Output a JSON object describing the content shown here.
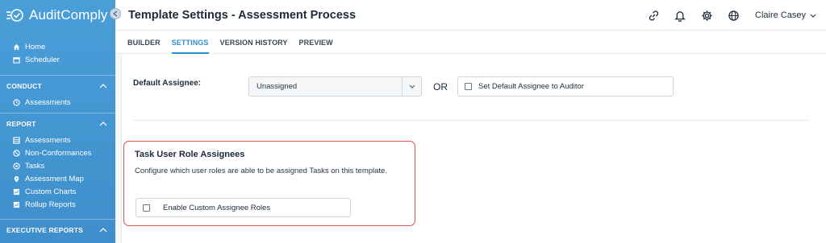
{
  "app": {
    "name": "AuditComply"
  },
  "colors": {
    "sidebar": "#4a9ed8",
    "accent": "#2b8fd0",
    "highlight_border": "#d9534f"
  },
  "sidebar": {
    "top_items": [
      {
        "label": "Home",
        "icon": "home-icon"
      },
      {
        "label": "Scheduler",
        "icon": "calendar-icon"
      }
    ],
    "sections": [
      {
        "title": "CONDUCT",
        "items": [
          {
            "label": "Assessments",
            "icon": "clock-icon"
          }
        ]
      },
      {
        "title": "REPORT",
        "items": [
          {
            "label": "Assessments",
            "icon": "table-icon"
          },
          {
            "label": "Non-Conformances",
            "icon": "warning-icon"
          },
          {
            "label": "Tasks",
            "icon": "tasks-icon"
          },
          {
            "label": "Assessment Map",
            "icon": "map-pin-icon"
          },
          {
            "label": "Custom Charts",
            "icon": "chart-icon"
          },
          {
            "label": "Rollup Reports",
            "icon": "chart-icon"
          }
        ]
      },
      {
        "title": "EXECUTIVE REPORTS",
        "items": []
      }
    ]
  },
  "header": {
    "title": "Template Settings - Assessment Process",
    "user": "Claire Casey"
  },
  "tabs": [
    {
      "label": "BUILDER",
      "active": false
    },
    {
      "label": "SETTINGS",
      "active": true
    },
    {
      "label": "VERSION HISTORY",
      "active": false
    },
    {
      "label": "PREVIEW",
      "active": false
    }
  ],
  "settings": {
    "default_assignee_label": "Default Assignee:",
    "default_assignee_value": "Unassigned",
    "or_text": "OR",
    "set_default_label": "Set Default Assignee to Auditor",
    "set_default_checked": false
  },
  "task_roles": {
    "title": "Task User Role Assignees",
    "description": "Configure which user roles are able to be assigned Tasks on this template.",
    "enable_label": "Enable Custom Assignee Roles",
    "enable_checked": false
  }
}
